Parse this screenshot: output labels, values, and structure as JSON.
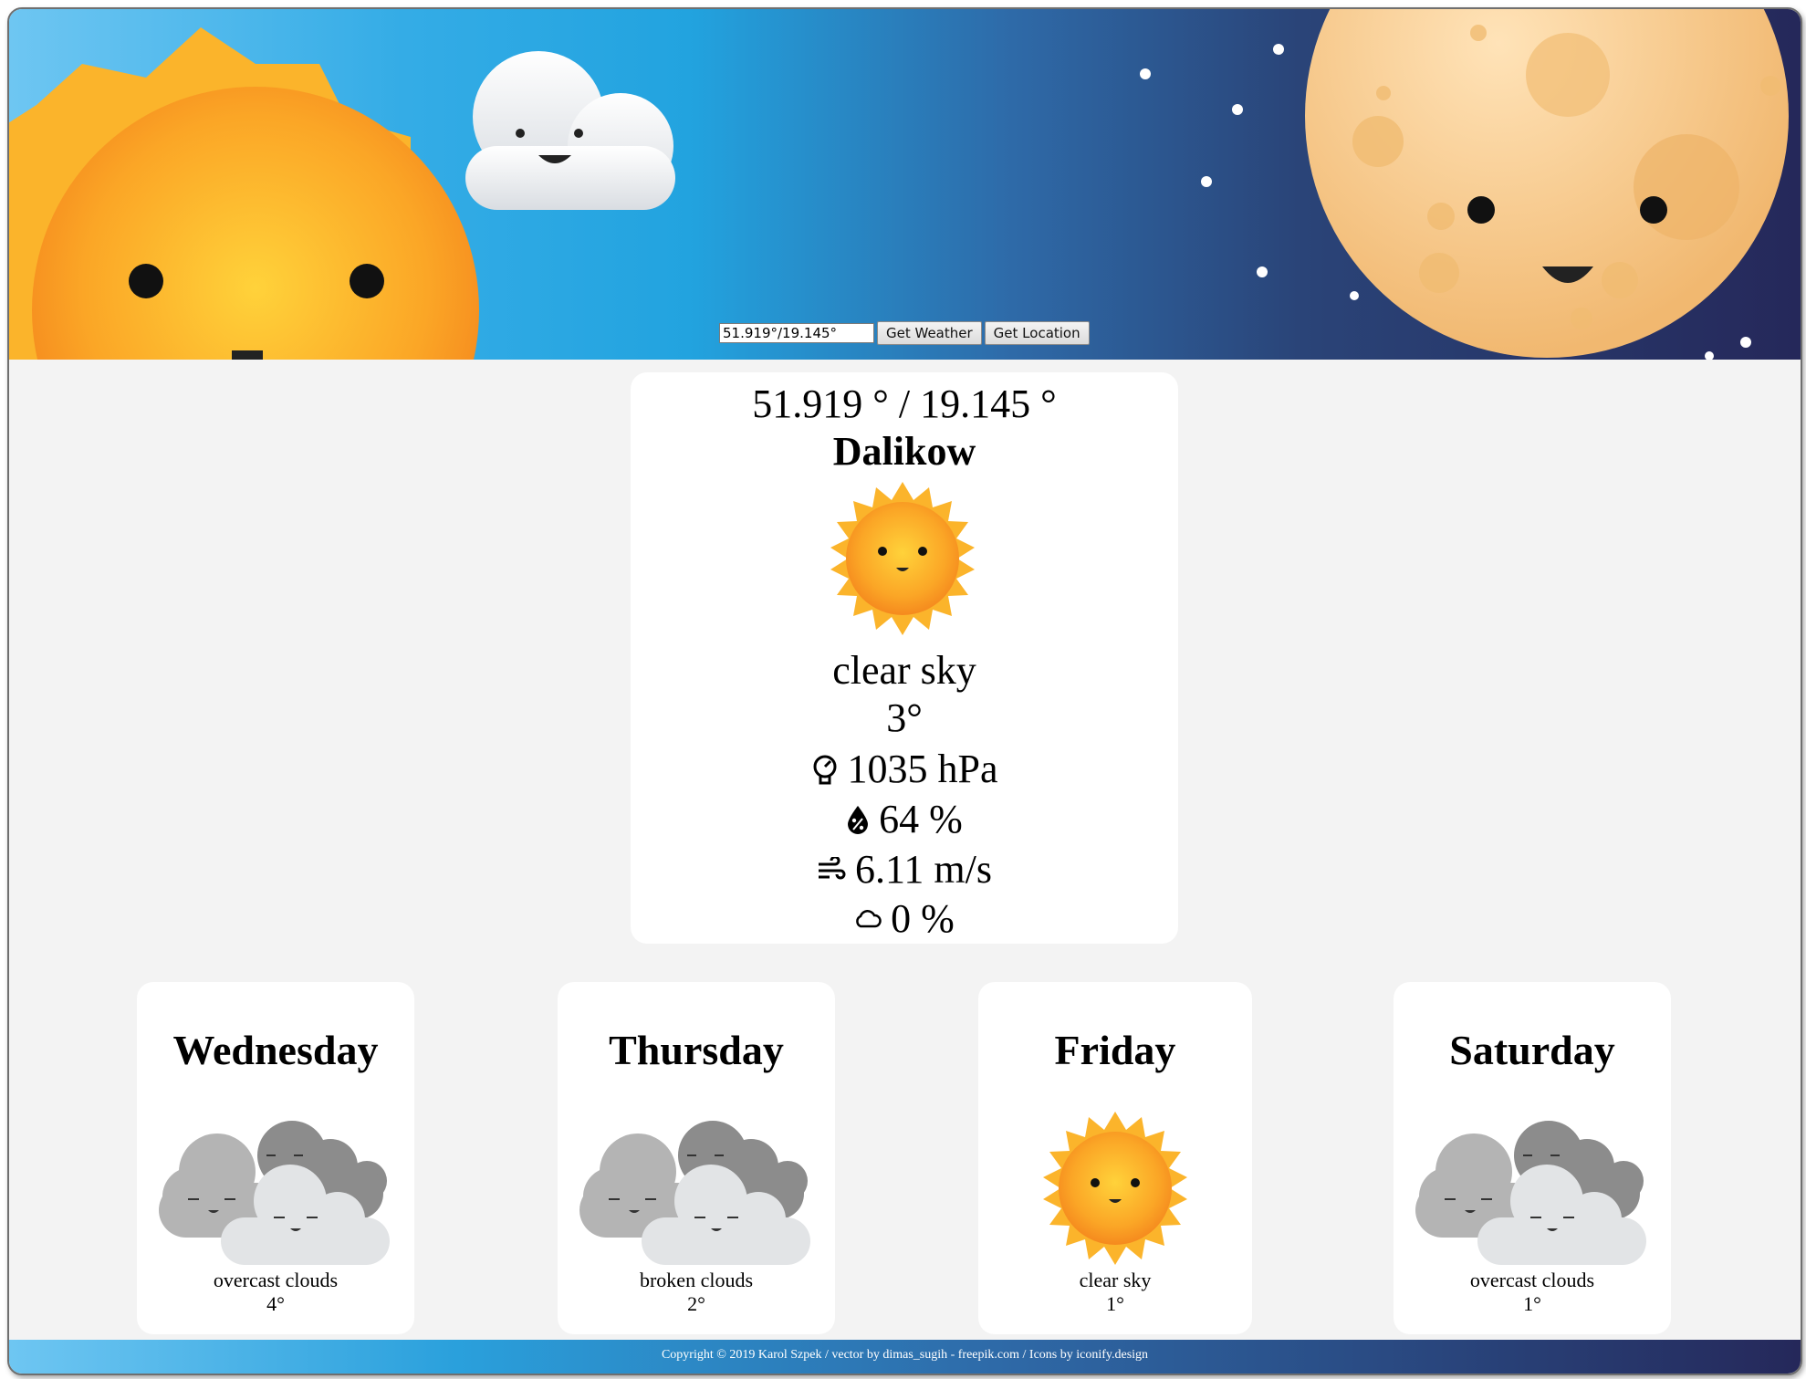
{
  "search": {
    "value": "51.919°/19.145°",
    "get_weather_label": "Get Weather",
    "get_location_label": "Get Location"
  },
  "current": {
    "coords": "51.919 ° / 19.145 °",
    "city": "Dalikow",
    "icon": "sun-icon",
    "description": "clear sky",
    "temperature": "3°",
    "pressure": "1035 hPa",
    "humidity": "64 %",
    "wind": "6.11 m/s",
    "cloudiness": "0 %"
  },
  "forecast": [
    {
      "day": "Wednesday",
      "icon": "overcast-clouds-icon",
      "description": "overcast clouds",
      "temperature": "4°"
    },
    {
      "day": "Thursday",
      "icon": "broken-clouds-icon",
      "description": "broken clouds",
      "temperature": "2°"
    },
    {
      "day": "Friday",
      "icon": "sun-icon",
      "description": "clear sky",
      "temperature": "1°"
    },
    {
      "day": "Saturday",
      "icon": "overcast-clouds-icon",
      "description": "overcast clouds",
      "temperature": "1°"
    }
  ],
  "footer": {
    "text": "Copyright © 2019 Karol Szpek /  vector by dimas_sugih - freepik.com /  Icons by iconify.design"
  },
  "colors": {
    "header_left": "#6ec6f2",
    "header_right": "#25285a",
    "page_background": "#f3f3f3",
    "card_background": "#ffffff"
  }
}
